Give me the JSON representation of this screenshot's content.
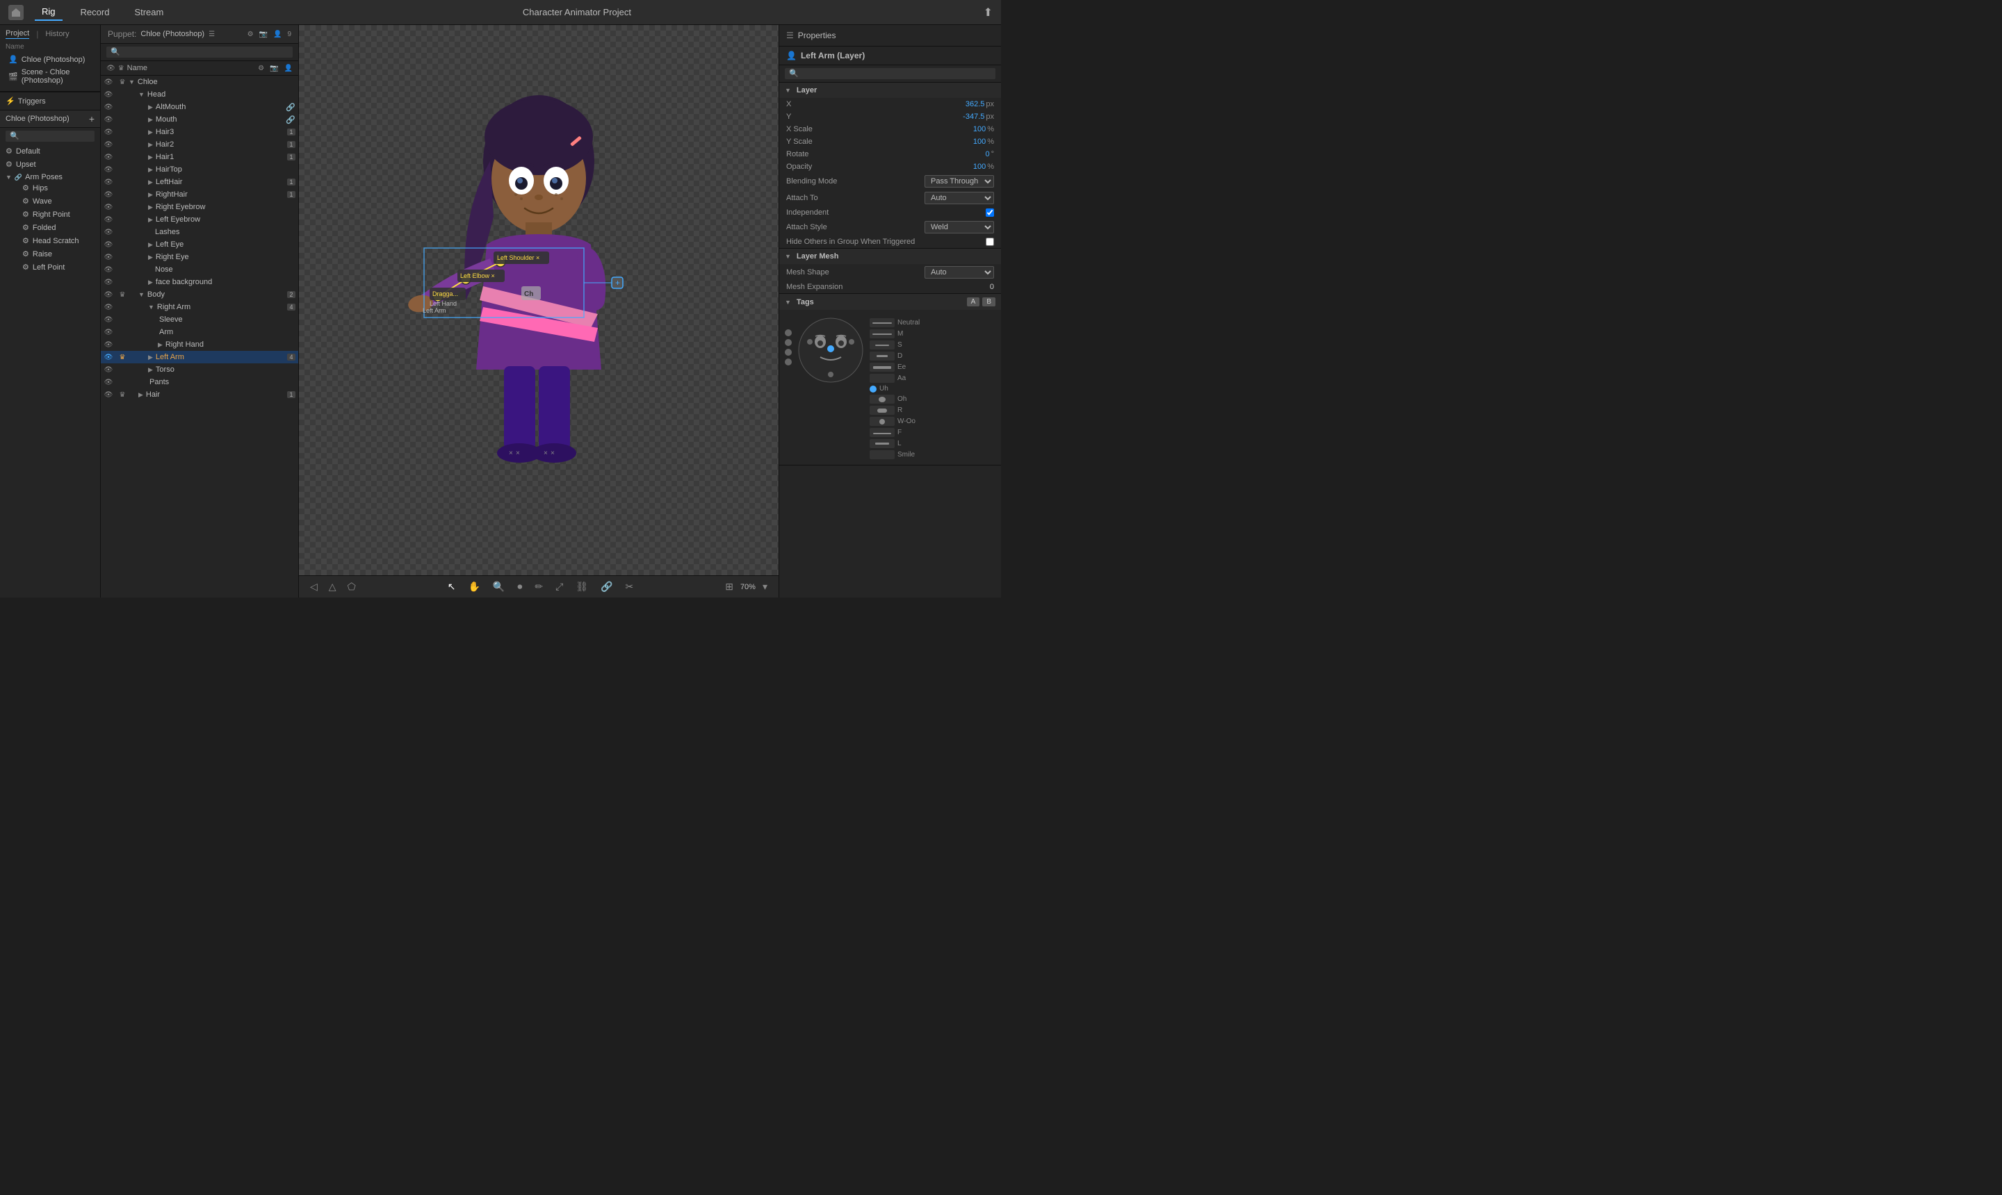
{
  "app": {
    "title": "Character Animator Project",
    "tabs": [
      "Rig",
      "Record",
      "Stream"
    ],
    "active_tab": "Rig"
  },
  "left_panel": {
    "project_tab": "Project",
    "history_tab": "History",
    "name_label": "Name",
    "items": [
      {
        "icon": "person",
        "label": "Chloe (Photoshop)"
      },
      {
        "icon": "scene",
        "label": "Scene - Chloe (Photoshop)"
      }
    ],
    "triggers": {
      "title": "Triggers",
      "puppet": "Chloe (Photoshop)",
      "add_button": "+",
      "items": [
        {
          "label": "Default",
          "key": ""
        },
        {
          "label": "Upset",
          "key": ""
        },
        {
          "label": "Arm Poses",
          "group": true,
          "children": [
            {
              "label": "Hips",
              "key": ""
            },
            {
              "label": "Wave",
              "key": ""
            },
            {
              "label": "Right Point",
              "key": ""
            },
            {
              "label": "Folded",
              "key": ""
            },
            {
              "label": "Head Scratch",
              "key": ""
            },
            {
              "label": "Raise",
              "key": ""
            },
            {
              "label": "Left Point",
              "key": ""
            }
          ]
        }
      ]
    }
  },
  "puppet_panel": {
    "title": "Puppet:",
    "puppet_name": "Chloe (Photoshop)",
    "badge": "9",
    "name_col": "Name",
    "layers": [
      {
        "id": "chloe",
        "name": "Chloe",
        "indent": 0,
        "vis": true,
        "crown": true,
        "expanded": true
      },
      {
        "id": "head",
        "name": "Head",
        "indent": 1,
        "vis": true,
        "crown": false,
        "expanded": true
      },
      {
        "id": "altmouth",
        "name": "AltMouth",
        "indent": 2,
        "vis": true,
        "crown": false,
        "has_side": true
      },
      {
        "id": "mouth",
        "name": "Mouth",
        "indent": 2,
        "vis": true,
        "crown": false,
        "has_side": true
      },
      {
        "id": "hair3",
        "name": "Hair3",
        "indent": 2,
        "vis": true,
        "crown": false,
        "badge": "1"
      },
      {
        "id": "hair2",
        "name": "Hair2",
        "indent": 2,
        "vis": true,
        "crown": false,
        "badge": "1"
      },
      {
        "id": "hair1",
        "name": "Hair1",
        "indent": 2,
        "vis": true,
        "crown": false,
        "badge": "1"
      },
      {
        "id": "hairtop",
        "name": "HairTop",
        "indent": 2,
        "vis": true,
        "crown": false
      },
      {
        "id": "lefthair",
        "name": "LeftHair",
        "indent": 2,
        "vis": true,
        "crown": false,
        "badge": "1"
      },
      {
        "id": "righthair",
        "name": "RightHair",
        "indent": 2,
        "vis": true,
        "crown": false,
        "badge": "1"
      },
      {
        "id": "righteyebrow",
        "name": "Right Eyebrow",
        "indent": 2,
        "vis": true,
        "crown": false
      },
      {
        "id": "lefteyebrow",
        "name": "Left Eyebrow",
        "indent": 2,
        "vis": true,
        "crown": false
      },
      {
        "id": "lashes",
        "name": "Lashes",
        "indent": 2,
        "vis": true,
        "crown": false
      },
      {
        "id": "lefteye",
        "name": "Left Eye",
        "indent": 2,
        "vis": true,
        "crown": false
      },
      {
        "id": "righteye",
        "name": "Right Eye",
        "indent": 2,
        "vis": true,
        "crown": false
      },
      {
        "id": "nose",
        "name": "Nose",
        "indent": 2,
        "vis": true,
        "crown": false
      },
      {
        "id": "facebg",
        "name": "face background",
        "indent": 2,
        "vis": true,
        "crown": false
      },
      {
        "id": "body",
        "name": "Body",
        "indent": 1,
        "vis": true,
        "crown": false,
        "badge": "2",
        "expanded": true
      },
      {
        "id": "rightarm",
        "name": "Right Arm",
        "indent": 2,
        "vis": true,
        "crown": false,
        "badge": "4",
        "expanded": true
      },
      {
        "id": "sleeve",
        "name": "Sleeve",
        "indent": 3,
        "vis": true,
        "crown": false
      },
      {
        "id": "arm",
        "name": "Arm",
        "indent": 3,
        "vis": true,
        "crown": false
      },
      {
        "id": "righthand",
        "name": "Right Hand",
        "indent": 3,
        "vis": true,
        "crown": false
      },
      {
        "id": "leftarm",
        "name": "Left Arm",
        "indent": 2,
        "vis": true,
        "crown": true,
        "badge": "4",
        "selected": true,
        "orange": true
      },
      {
        "id": "torso",
        "name": "Torso",
        "indent": 2,
        "vis": true,
        "crown": false
      },
      {
        "id": "pants",
        "name": "Pants",
        "indent": 2,
        "vis": true,
        "crown": false
      },
      {
        "id": "hair",
        "name": "Hair",
        "indent": 1,
        "vis": true,
        "crown": false,
        "badge": "1"
      }
    ]
  },
  "properties_panel": {
    "title": "Properties",
    "layer_title": "Left Arm (Layer)",
    "sections": {
      "layer": {
        "title": "Layer",
        "fields": [
          {
            "label": "X",
            "value": "362.5",
            "unit": "px"
          },
          {
            "label": "Y",
            "value": "-347.5",
            "unit": "px"
          },
          {
            "label": "X Scale",
            "value": "100",
            "unit": "%"
          },
          {
            "label": "Y Scale",
            "value": "100",
            "unit": "%"
          },
          {
            "label": "Rotate",
            "value": "0",
            "unit": "°"
          },
          {
            "label": "Opacity",
            "value": "100",
            "unit": "%"
          }
        ],
        "blending_mode_label": "Blending Mode",
        "blending_mode_value": "Pass Through",
        "attach_to_label": "Attach To",
        "attach_to_value": "Auto",
        "independent_label": "Independent",
        "independent_checked": true,
        "attach_style_label": "Attach Style",
        "attach_style_value": "Weld",
        "hide_others_label": "Hide Others in Group When Triggered",
        "hide_others_checked": false
      },
      "layer_mesh": {
        "title": "Layer Mesh",
        "mesh_shape_label": "Mesh Shape",
        "mesh_shape_value": "Auto",
        "mesh_expansion_label": "Mesh Expansion",
        "mesh_expansion_value": "0"
      },
      "tags": {
        "title": "Tags"
      }
    }
  },
  "face_panel": {
    "a_button": "A",
    "b_button": "B",
    "visemes": [
      {
        "label": "Neutral"
      },
      {
        "label": "M"
      },
      {
        "label": "S"
      },
      {
        "label": "D"
      },
      {
        "label": "Ee"
      },
      {
        "label": "Aa"
      },
      {
        "label": "Uh"
      },
      {
        "label": "Oh"
      },
      {
        "label": "R"
      },
      {
        "label": "W-Oo"
      },
      {
        "label": "F"
      },
      {
        "label": "L"
      },
      {
        "label": "Smile"
      }
    ]
  },
  "canvas": {
    "zoom": "70%",
    "tools": [
      "arrow-left",
      "triangle",
      "pentagon",
      "cursor",
      "hand",
      "magnify",
      "record-circle",
      "edit",
      "transform",
      "link",
      "chain",
      "lasso"
    ]
  }
}
